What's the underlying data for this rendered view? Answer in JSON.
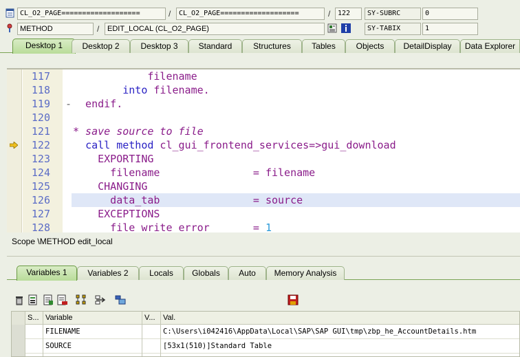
{
  "header": {
    "row1": {
      "program": "CL_O2_PAGE===================",
      "include": "CL_O2_PAGE===================",
      "line": "122",
      "sysfield": "SY-SUBRC",
      "sysvalue": "0"
    },
    "row2": {
      "type": "METHOD",
      "name": "EDIT_LOCAL (CL_O2_PAGE)",
      "sysfield": "SY-TABIX",
      "sysvalue": "1"
    }
  },
  "desktop_tabs": [
    "Desktop 1",
    "Desktop 2",
    "Desktop 3",
    "Standard",
    "Structures",
    "Tables",
    "Objects",
    "DetailDisplay",
    "Data Explorer"
  ],
  "code": {
    "lines": [
      {
        "num": "117",
        "text": "            filename"
      },
      {
        "num": "118",
        "text": "        into filename."
      },
      {
        "num": "119",
        "text": "  endif."
      },
      {
        "num": "120",
        "text": ""
      },
      {
        "num": "121",
        "text": "* save source to file"
      },
      {
        "num": "122",
        "text": "  call method cl_gui_frontend_services=>gui_download"
      },
      {
        "num": "123",
        "text": "    EXPORTING"
      },
      {
        "num": "124",
        "text": "      filename               = filename"
      },
      {
        "num": "125",
        "text": "    CHANGING"
      },
      {
        "num": "126",
        "text": "      data_tab               = source"
      },
      {
        "num": "127",
        "text": "    EXCEPTIONS"
      },
      {
        "num": "128",
        "text": "      file_write_error       = 1"
      }
    ]
  },
  "scope": "Scope \\METHOD edit_local",
  "variable_tabs": [
    "Variables 1",
    "Variables 2",
    "Locals",
    "Globals",
    "Auto",
    "Memory Analysis"
  ],
  "grid": {
    "headers": [
      "S...",
      "Variable",
      "V...",
      "Val."
    ],
    "rows": [
      {
        "variable": "FILENAME",
        "value": "C:\\Users\\i042416\\AppData\\Local\\SAP\\SAP GUI\\tmp\\zbp_he_AccountDetails.htm"
      },
      {
        "variable": "SOURCE",
        "value": "[53x1(510)]Standard Table"
      }
    ]
  },
  "colors": {
    "active_tab": "#b9dc9a",
    "keyword": "#2a22c4",
    "identifier": "#8a1c8a",
    "comment": "#8b8b8b",
    "line_number": "#5b6cc6",
    "highlight_line": "#dfe7f7"
  }
}
